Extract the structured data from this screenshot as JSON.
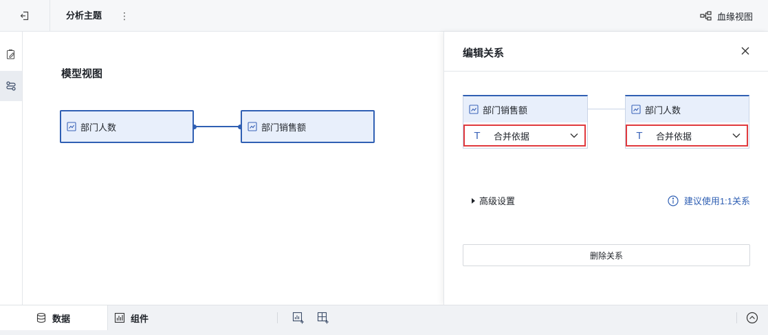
{
  "header": {
    "title": "分析主题",
    "more_label": "⋮",
    "lineage_label": "血缘视图"
  },
  "canvas": {
    "title": "模型视图",
    "nodes": [
      {
        "label": "部门人数"
      },
      {
        "label": "部门销售额"
      }
    ]
  },
  "panel": {
    "title": "编辑关系",
    "close_label": "×",
    "left_table": {
      "name": "部门销售额",
      "field": "合并依据"
    },
    "right_table": {
      "name": "部门人数",
      "field": "合并依据"
    },
    "advanced_label": "高级设置",
    "suggestion_label": "建议使用1:1关系",
    "delete_label": "删除关系"
  },
  "bottom": {
    "tabs": [
      {
        "label": "数据",
        "active": true
      },
      {
        "label": "组件",
        "active": false
      }
    ]
  },
  "colors": {
    "accent": "#2f5fb3",
    "node_fill": "#e8effb",
    "highlight": "#e0383c"
  }
}
